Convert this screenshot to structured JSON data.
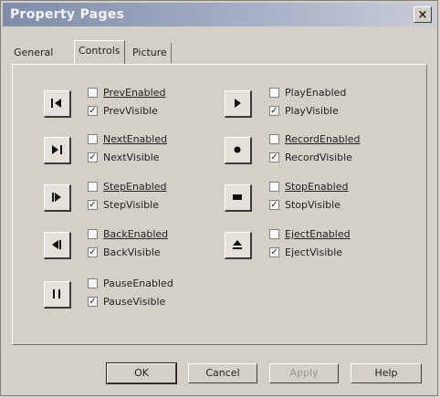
{
  "window": {
    "title": "Property Pages",
    "close_glyph": "×"
  },
  "tabs": [
    {
      "label": "General"
    },
    {
      "label": "Controls"
    },
    {
      "label": "Picture"
    }
  ],
  "left_controls": [
    {
      "icon": "prev-icon",
      "enabled_label": "PrevEnabled",
      "enabled_checked": false,
      "visible_label": "PrevVisible",
      "visible_checked": true
    },
    {
      "icon": "next-icon",
      "enabled_label": "NextEnabled",
      "enabled_checked": false,
      "visible_label": "NextVisible",
      "visible_checked": true
    },
    {
      "icon": "step-icon",
      "enabled_label": "StepEnabled",
      "enabled_checked": false,
      "visible_label": "StepVisible",
      "visible_checked": true
    },
    {
      "icon": "back-icon",
      "enabled_label": "BackEnabled",
      "enabled_checked": false,
      "visible_label": "BackVisible",
      "visible_checked": true
    },
    {
      "icon": "pause-icon",
      "enabled_label": "PauseEnabled",
      "enabled_checked": false,
      "visible_label": "PauseVisible",
      "visible_checked": true
    }
  ],
  "right_controls": [
    {
      "icon": "play-icon",
      "enabled_label": "PlayEnabled",
      "enabled_checked": false,
      "visible_label": "PlayVisible",
      "visible_checked": true
    },
    {
      "icon": "record-icon",
      "enabled_label": "RecordEnabled",
      "enabled_checked": false,
      "visible_label": "RecordVisible",
      "visible_checked": true
    },
    {
      "icon": "stop-icon",
      "enabled_label": "StopEnabled",
      "enabled_checked": false,
      "visible_label": "StopVisible",
      "visible_checked": true
    },
    {
      "icon": "eject-icon",
      "enabled_label": "EjectEnabled",
      "enabled_checked": false,
      "visible_label": "EjectVisible",
      "visible_checked": true
    }
  ],
  "buttons": {
    "ok": "OK",
    "cancel": "Cancel",
    "apply": "Apply",
    "help": "Help"
  }
}
